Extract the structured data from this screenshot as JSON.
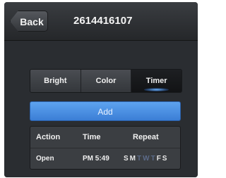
{
  "navbar": {
    "back_label": "Back",
    "title": "2614416107"
  },
  "tabs": [
    {
      "label": "Bright",
      "active": false
    },
    {
      "label": "Color",
      "active": false
    },
    {
      "label": "Timer",
      "active": true
    }
  ],
  "add_label": "Add",
  "table": {
    "headers": {
      "action": "Action",
      "time": "Time",
      "repeat": "Repeat"
    },
    "rows": [
      {
        "action": "Open",
        "time": "PM 5:49",
        "days": [
          {
            "label": "S",
            "active": true
          },
          {
            "label": "M",
            "active": true
          },
          {
            "label": "T",
            "active": false
          },
          {
            "label": "W",
            "active": false
          },
          {
            "label": "T",
            "active": false
          },
          {
            "label": "F",
            "active": true
          },
          {
            "label": "S",
            "active": true
          }
        ]
      }
    ]
  },
  "colors": {
    "accent": "#4a90e2",
    "background": "#2a2d31"
  }
}
